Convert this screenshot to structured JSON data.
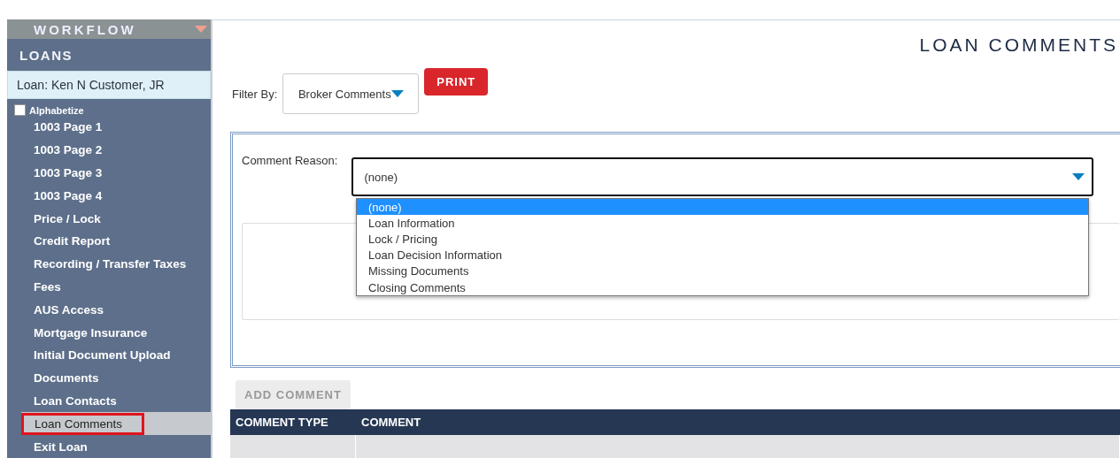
{
  "sidebar": {
    "header": "WORKFLOW",
    "section": "LOANS",
    "loan": "Loan: Ken N Customer, JR",
    "alphabetize": {
      "label": "Alphabetize",
      "checked": false
    },
    "items": [
      {
        "label": "1003 Page 1",
        "selected": false
      },
      {
        "label": "1003 Page 2",
        "selected": false
      },
      {
        "label": "1003 Page 3",
        "selected": false
      },
      {
        "label": "1003 Page 4",
        "selected": false
      },
      {
        "label": "Price / Lock",
        "selected": false
      },
      {
        "label": "Credit Report",
        "selected": false
      },
      {
        "label": "Recording / Transfer Taxes",
        "selected": false
      },
      {
        "label": "Fees",
        "selected": false
      },
      {
        "label": "AUS Access",
        "selected": false
      },
      {
        "label": "Mortgage Insurance",
        "selected": false
      },
      {
        "label": "Initial Document Upload",
        "selected": false
      },
      {
        "label": "Documents",
        "selected": false
      },
      {
        "label": "Loan Contacts",
        "selected": false
      },
      {
        "label": "Loan Comments",
        "selected": true
      },
      {
        "label": "Exit Loan",
        "selected": false
      }
    ]
  },
  "title": "LOAN COMMENTS",
  "filter": {
    "label": "Filter By:",
    "value": "Broker Comments"
  },
  "print_button": "PRINT",
  "comment_reason": {
    "label": "Comment Reason:",
    "value": "(none)",
    "expanded": true,
    "options": [
      {
        "label": "(none)",
        "selected": true
      },
      {
        "label": "Loan Information",
        "selected": false
      },
      {
        "label": "Lock / Pricing",
        "selected": false
      },
      {
        "label": "Loan Decision Information",
        "selected": false
      },
      {
        "label": "Missing Documents",
        "selected": false
      },
      {
        "label": "Closing Comments",
        "selected": false
      }
    ]
  },
  "add_comment_button": {
    "label": "ADD COMMENT",
    "disabled": true
  },
  "table": {
    "columns": [
      "COMMENT TYPE",
      "COMMENT"
    ]
  }
}
